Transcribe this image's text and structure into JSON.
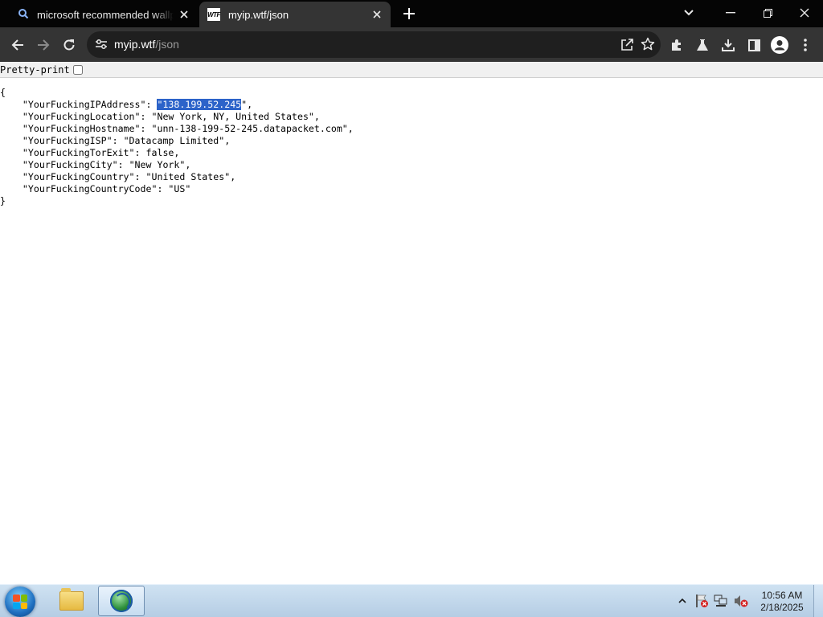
{
  "browser": {
    "tabs": [
      {
        "title": "microsoft recommended wallpapers",
        "favicon": "search-icon",
        "active": false
      },
      {
        "title": "myip.wtf/json",
        "favicon": "wtf-favicon",
        "favicon_text": "WTF",
        "active": true
      }
    ],
    "address": {
      "host": "myip.wtf",
      "path": "/json"
    }
  },
  "page": {
    "pretty_print_label": "Pretty-print",
    "pretty_print_checked": false,
    "json_open": "{",
    "json_close": "}",
    "entries": [
      {
        "key": "\"YourFuckingIPAddress\"",
        "value": "\"138.199.52.245\""
      },
      {
        "key": "\"YourFuckingLocation\"",
        "value": "\"New York, NY, United States\""
      },
      {
        "key": "\"YourFuckingHostname\"",
        "value": "\"unn-138-199-52-245.datapacket.com\""
      },
      {
        "key": "\"YourFuckingISP\"",
        "value": "\"Datacamp Limited\""
      },
      {
        "key": "\"YourFuckingTorExit\"",
        "value": "false"
      },
      {
        "key": "\"YourFuckingCity\"",
        "value": "\"New York\""
      },
      {
        "key": "\"YourFuckingCountry\"",
        "value": "\"United States\""
      },
      {
        "key": "\"YourFuckingCountryCode\"",
        "value": "\"US\""
      }
    ],
    "selected_text": "\"138.199.52.245"
  },
  "taskbar": {
    "time": "10:56 AM",
    "date": "2/18/2025"
  },
  "colors": {
    "tabstrip": "#050505",
    "toolbar": "#343434",
    "omnibox": "#1f1f1f",
    "selection": "#2c63c9"
  }
}
